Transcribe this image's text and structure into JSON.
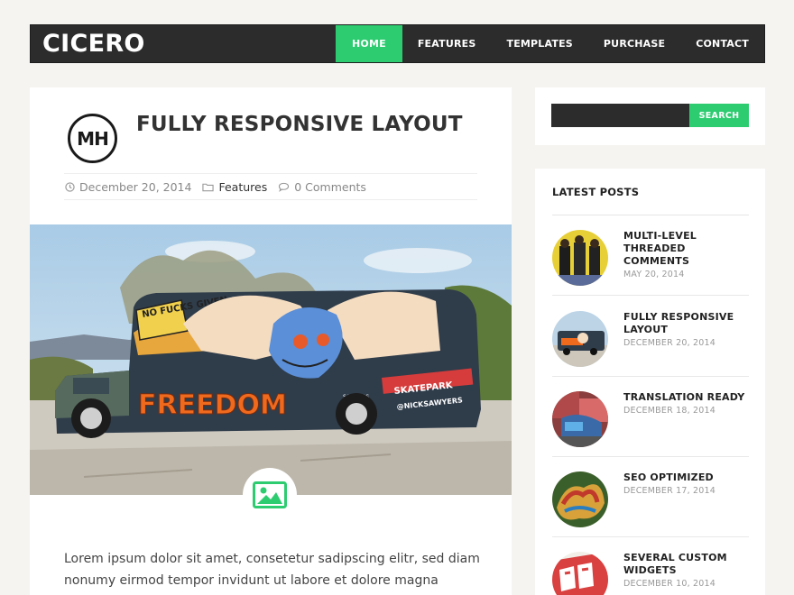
{
  "header": {
    "logo": "CICERO",
    "nav": [
      {
        "label": "HOME",
        "active": true
      },
      {
        "label": "FEATURES",
        "active": false
      },
      {
        "label": "TEMPLATES",
        "active": false
      },
      {
        "label": "PURCHASE",
        "active": false
      },
      {
        "label": "CONTACT",
        "active": false
      }
    ]
  },
  "article": {
    "author_logo": "MH",
    "title": "FULLY RESPONSIVE LAYOUT",
    "date": "December 20, 2014",
    "category": "Features",
    "comments": "0 Comments",
    "hero_graffiti": {
      "top": "NO FUCKS GIVEN",
      "main": "FREEDOM",
      "side": "SKATEPARK",
      "tag": "@NICKSAWYERS",
      "small": "SAWYERS"
    },
    "excerpt": "Lorem ipsum dolor sit amet, consetetur sadipscing elitr, sed diam nonumy eirmod tempor invidunt ut labore et dolore magna aliquyam"
  },
  "sidebar": {
    "search": {
      "placeholder": "",
      "button": "SEARCH"
    },
    "latest": {
      "title": "LATEST POSTS",
      "items": [
        {
          "title": "MULTI-LEVEL THREADED COMMENTS",
          "date": "MAY 20, 2014",
          "thumb": "band-icon"
        },
        {
          "title": "FULLY RESPONSIVE LAYOUT",
          "date": "DECEMBER 20, 2014",
          "thumb": "bus-icon"
        },
        {
          "title": "TRANSLATION READY",
          "date": "DECEMBER 18, 2014",
          "thumb": "street-art-icon"
        },
        {
          "title": "SEO OPTIMIZED",
          "date": "DECEMBER 17, 2014",
          "thumb": "graffiti-icon"
        },
        {
          "title": "SEVERAL CUSTOM WIDGETS",
          "date": "DECEMBER 10, 2014",
          "thumb": "bam-icon"
        }
      ]
    }
  },
  "colors": {
    "accent": "#2ecc71",
    "dark": "#2c2c2c",
    "background": "#f5f4f1"
  }
}
